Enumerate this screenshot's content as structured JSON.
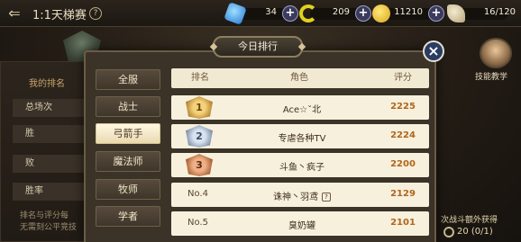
{
  "header": {
    "back_glyph": "⇐",
    "title": "1:1天梯赛",
    "help_glyph": "?"
  },
  "resources": [
    {
      "icon": "gem-icon",
      "value": "34"
    },
    {
      "icon": "moon-icon",
      "value": "209"
    },
    {
      "icon": "coin-icon",
      "value": "11210"
    },
    {
      "icon": "stamina-icon",
      "value": "16/120"
    }
  ],
  "left_panel": {
    "title": "我的排名",
    "rows": [
      "总场次",
      "胜",
      "败",
      "胜率"
    ],
    "note_lines": [
      "排名与评分每",
      "无需刻公平竞技"
    ]
  },
  "right_panel": {
    "skill_label": "技能教学",
    "note": "次战斗额外获得",
    "count": "20 (0/1)"
  },
  "modal": {
    "title": "今日排行",
    "close_glyph": "×",
    "categories": [
      "全服",
      "战士",
      "弓箭手",
      "魔法师",
      "牧师",
      "学者"
    ],
    "active_category_index": 2,
    "columns": {
      "rank": "排名",
      "role": "角色",
      "score": "评分"
    },
    "rows": [
      {
        "rank": "1",
        "medal": "gold",
        "name": "Ace☆ˇ北",
        "score": "2225"
      },
      {
        "rank": "2",
        "medal": "silver",
        "name": "专虐各种TV",
        "score": "2224"
      },
      {
        "rank": "3",
        "medal": "bronze",
        "name": "斗鱼丶疯子",
        "score": "2200"
      },
      {
        "rank": "No.4",
        "medal": "",
        "name": "诛神丶羽鸢",
        "tag": "?",
        "score": "2129"
      },
      {
        "rank": "No.5",
        "medal": "",
        "name": "臭奶罐",
        "score": "2101"
      }
    ]
  }
}
